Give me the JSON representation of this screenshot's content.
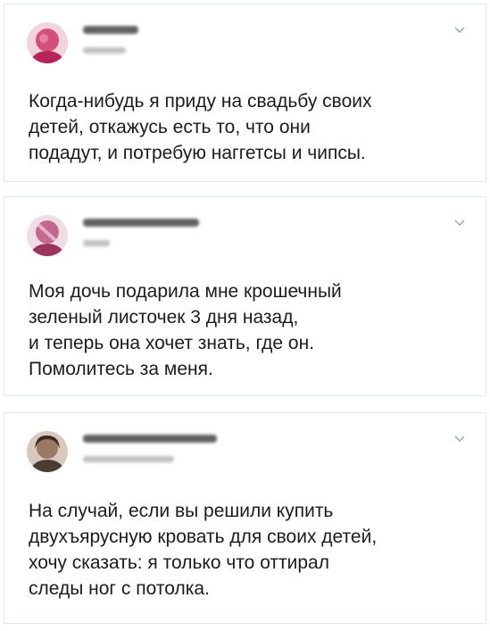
{
  "tweets": [
    {
      "text": "Когда-нибудь я приду на свадьбу своих\nдетей, откажусь есть то, что они\nподадут, и потребую наггетсы и чипсы.",
      "avatar_colors": [
        "#c22a57",
        "#e06a8e",
        "#f1c3cf"
      ],
      "menu_icon": "chevron-down-icon"
    },
    {
      "text": "Моя дочь подарила мне крошечный\nзеленый листочек 3 дня назад,\nи теперь она хочет знать, где он.\nПомолитесь за меня.",
      "avatar_colors": [
        "#a83c66",
        "#d98aa6",
        "#f0d8e0"
      ],
      "menu_icon": "chevron-down-icon"
    },
    {
      "text": "На случай, если вы решили купить\nдвухъярусную кровать для своих детей,\nхочу сказать: я только что оттирал\nследы ног с потолка.",
      "avatar_colors": [
        "#4a3b33",
        "#8a6a58",
        "#c8b0a0"
      ],
      "menu_icon": "chevron-down-icon"
    }
  ]
}
